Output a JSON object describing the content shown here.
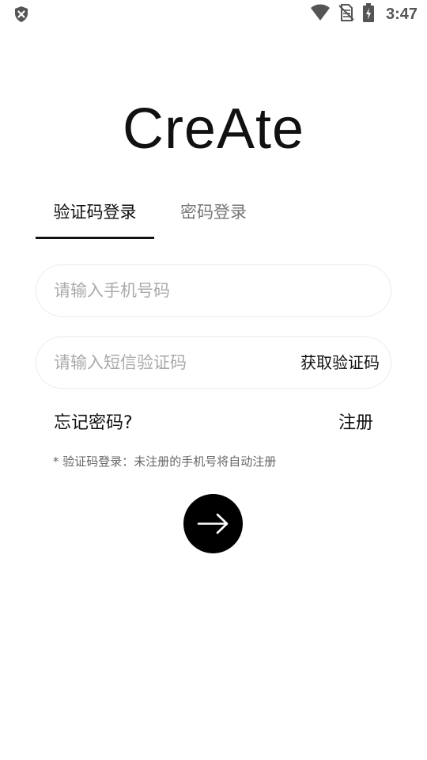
{
  "status_bar": {
    "time": "3:47",
    "icons": [
      "shield-x-icon",
      "wifi-icon",
      "no-sim-icon",
      "battery-charging-icon"
    ]
  },
  "app": {
    "title": "CreAte"
  },
  "tabs": [
    {
      "label": "验证码登录",
      "active": true
    },
    {
      "label": "密码登录",
      "active": false
    }
  ],
  "form": {
    "phone_placeholder": "请输入手机号码",
    "code_placeholder": "请输入短信验证码",
    "get_code_label": "获取验证码",
    "forgot_label": "忘记密码?",
    "register_label": "注册",
    "hint": "* 验证码登录：未注册的手机号将自动注册"
  },
  "submit": {
    "icon": "arrow-right-icon"
  },
  "colors": {
    "primary": "#000000",
    "inactive_tab": "#777777",
    "placeholder": "#aaaaaa",
    "hint": "#666666",
    "border": "#ececec"
  }
}
